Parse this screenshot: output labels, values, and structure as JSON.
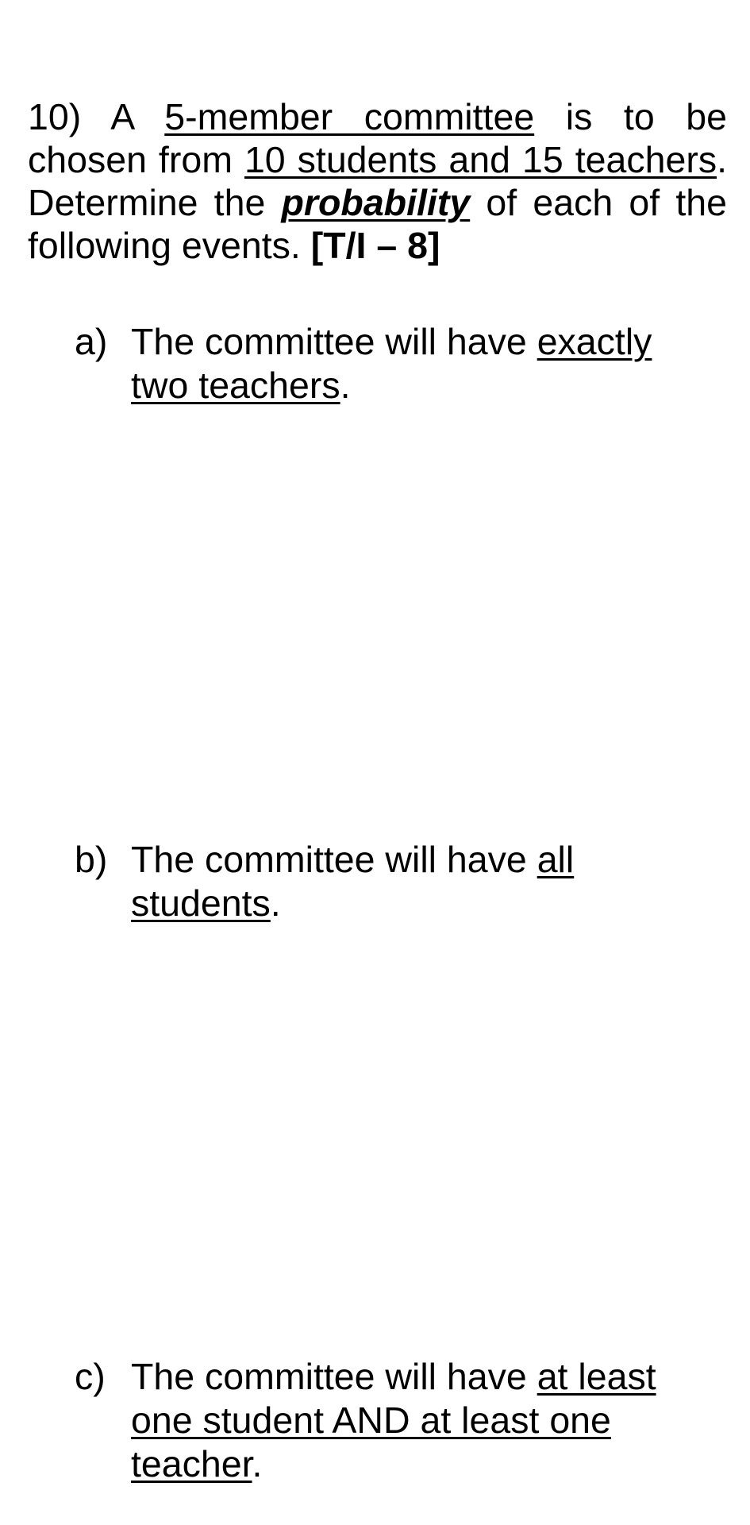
{
  "question": {
    "number": "10)",
    "intro_1": "A",
    "u_committee": "5-member committee",
    "intro_2": "is to be chosen from",
    "u_pool": "10 students and 15 teachers",
    "intro_3": ". Determine the",
    "u_probability": "probability",
    "intro_4": "of each of the following events.",
    "marks": "[T/I – 8]"
  },
  "parts": [
    {
      "marker": "a)",
      "prefix": "The committee will have",
      "underlined": "exactly two teachers",
      "suffix": "."
    },
    {
      "marker": "b)",
      "prefix": "The committee will have",
      "underlined": "all students",
      "suffix": "."
    },
    {
      "marker": "c)",
      "prefix": "The committee will have",
      "underlined": "at least one student AND at least one teacher",
      "suffix": "."
    }
  ]
}
